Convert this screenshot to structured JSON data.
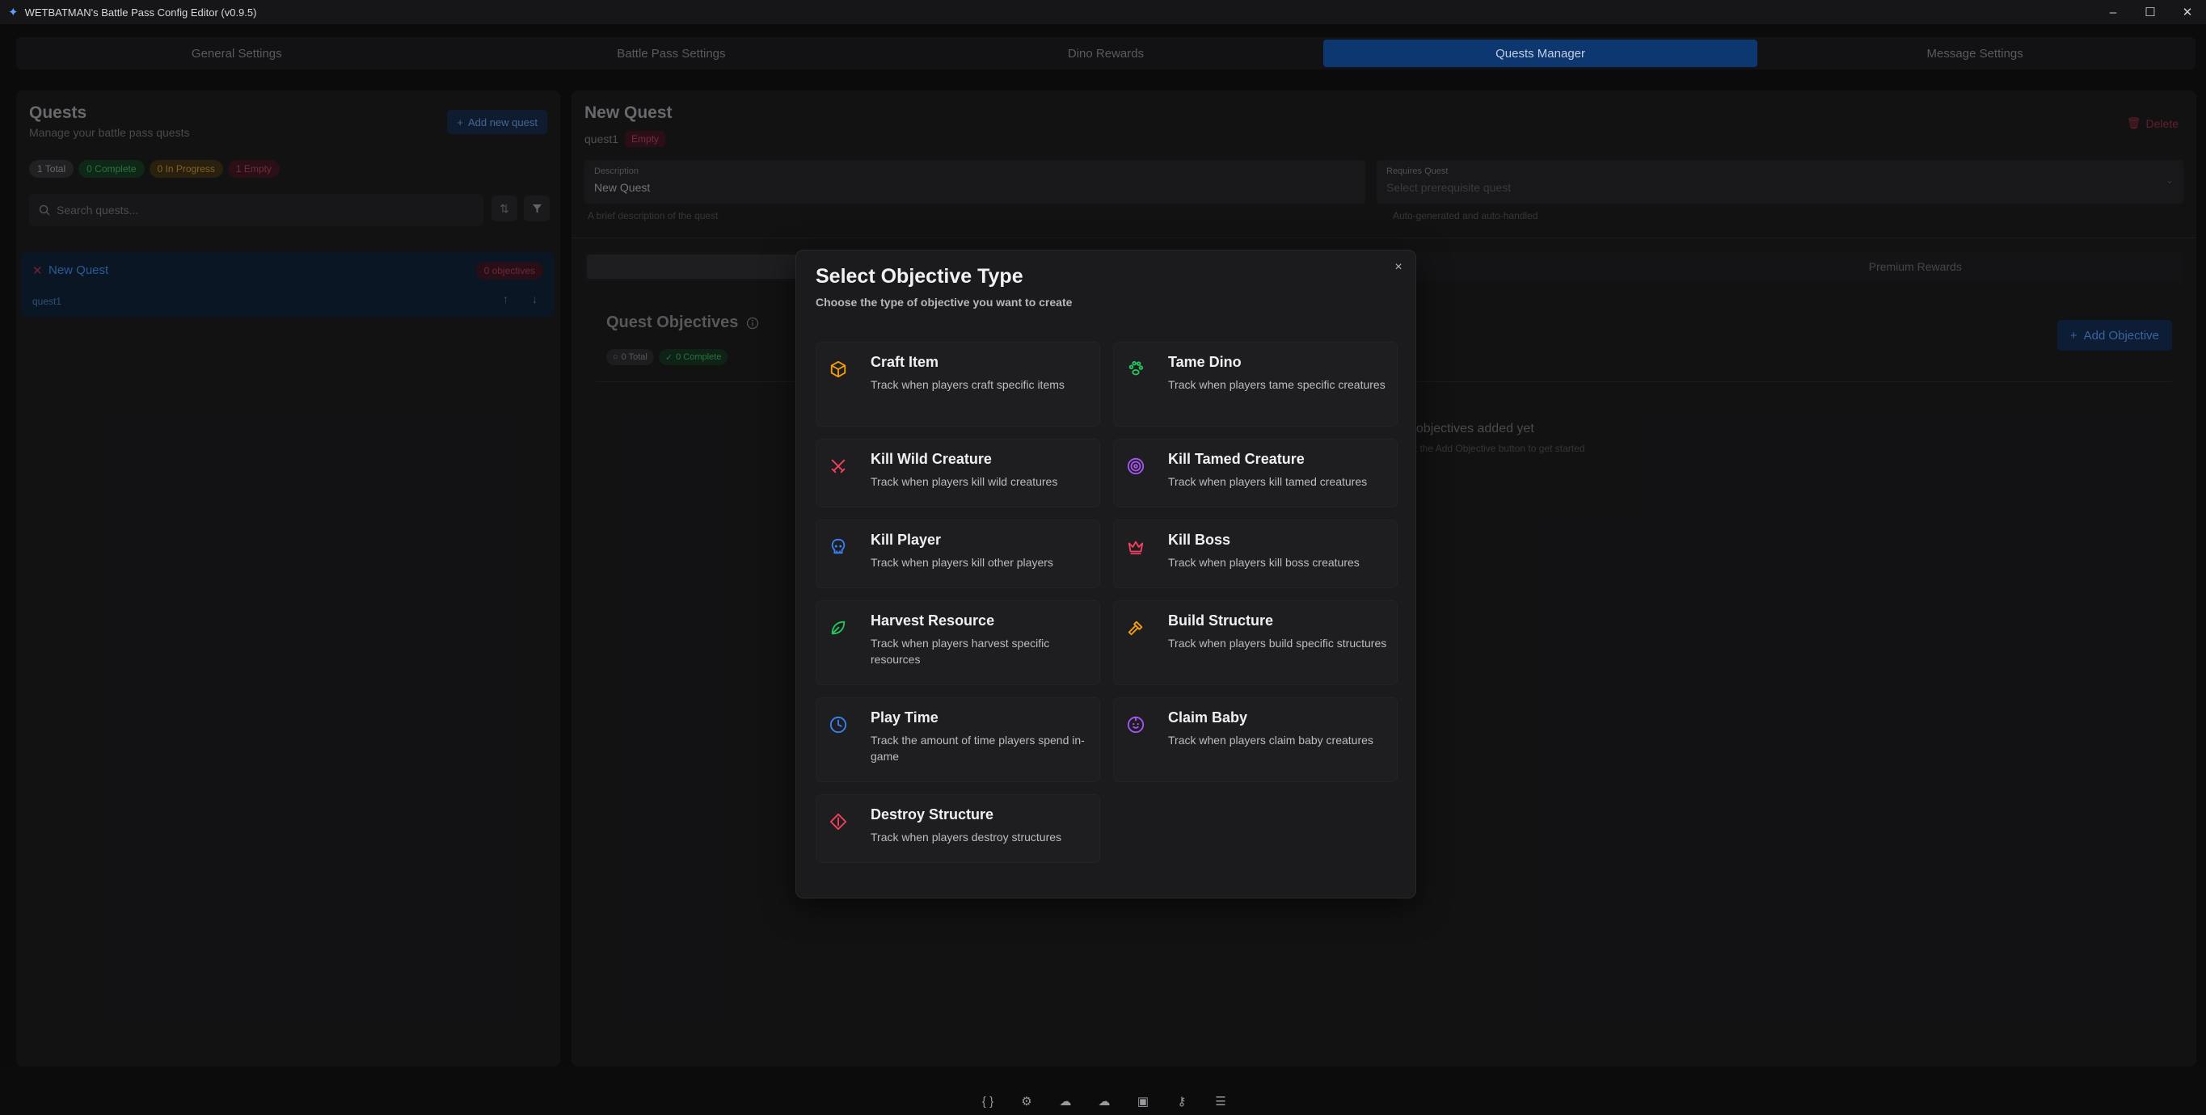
{
  "window": {
    "title": "WETBATMAN's Battle Pass Config Editor (v0.9.5)",
    "controls": {
      "minimize": "–",
      "maximize": "☐",
      "close": "✕"
    }
  },
  "tabs": [
    {
      "label": "General Settings"
    },
    {
      "label": "Battle Pass Settings"
    },
    {
      "label": "Dino Rewards"
    },
    {
      "label": "Quests Manager"
    },
    {
      "label": "Message Settings"
    }
  ],
  "quests_panel": {
    "title": "Quests",
    "subtitle": "Manage your battle pass quests",
    "add_button": "Add new quest",
    "chips": {
      "total": "1 Total",
      "complete": "0 Complete",
      "in_progress": "0 In Progress",
      "empty": "1 Empty"
    },
    "search_placeholder": "Search quests...",
    "items": [
      {
        "name": "New Quest",
        "id": "quest1",
        "badge": "0 objectives"
      }
    ]
  },
  "quest_detail": {
    "title": "New Quest",
    "id": "quest1",
    "status": "Empty",
    "delete_label": "Delete",
    "description": {
      "label": "Description",
      "value": "New Quest",
      "hint": "A brief description of the quest"
    },
    "requires": {
      "label": "Requires Quest",
      "placeholder": "Select prerequisite quest",
      "hint": "Auto-generated and auto-handled"
    },
    "subtabs": {
      "objectives": "Objectives",
      "rewards": "Rewards",
      "premium": "Premium Rewards"
    },
    "objectives_title": "Quest Objectives",
    "chips": {
      "total": "0 Total",
      "complete": "0 Complete"
    },
    "add_objective": "Add Objective",
    "empty_title": "No objectives added yet",
    "empty_sub": "Click the Add Objective button to get started"
  },
  "modal": {
    "title": "Select Objective Type",
    "subtitle": "Choose the type of objective you want to create",
    "close": "×",
    "objectives": [
      {
        "name": "Craft Item",
        "desc": "Track when players craft specific items",
        "icon": "box-icon",
        "color": "#f59e0b"
      },
      {
        "name": "Tame Dino",
        "desc": "Track when players tame specific creatures",
        "icon": "paw-icon",
        "color": "#22c55e"
      },
      {
        "name": "Kill Wild Creature",
        "desc": "Track when players kill wild creatures",
        "icon": "swords-icon",
        "color": "#f43f5e"
      },
      {
        "name": "Kill Tamed Creature",
        "desc": "Track when players kill tamed creatures",
        "icon": "target-icon",
        "color": "#a855f7"
      },
      {
        "name": "Kill Player",
        "desc": "Track when players kill other players",
        "icon": "skull-icon",
        "color": "#3b82f6"
      },
      {
        "name": "Kill Boss",
        "desc": "Track when players kill boss creatures",
        "icon": "crown-icon",
        "color": "#f43f5e"
      },
      {
        "name": "Harvest Resource",
        "desc": "Track when players harvest specific resources",
        "icon": "leaf-icon",
        "color": "#22c55e"
      },
      {
        "name": "Build Structure",
        "desc": "Track when players build specific structures",
        "icon": "hammer-icon",
        "color": "#f59e0b"
      },
      {
        "name": "Play Time",
        "desc": "Track the amount of time players spend in-game",
        "icon": "clock-icon",
        "color": "#3b82f6"
      },
      {
        "name": "Claim Baby",
        "desc": "Track when players claim baby creatures",
        "icon": "baby-icon",
        "color": "#a855f7"
      },
      {
        "name": "Destroy Structure",
        "desc": "Track when players destroy structures",
        "icon": "diamond-alert-icon",
        "color": "#f43f5e"
      }
    ]
  },
  "toolbar": {
    "items": [
      "braces-icon",
      "gear-icon",
      "cloud-upload-icon",
      "cloud-download-icon",
      "save-icon",
      "key-icon",
      "search-list-icon"
    ]
  }
}
